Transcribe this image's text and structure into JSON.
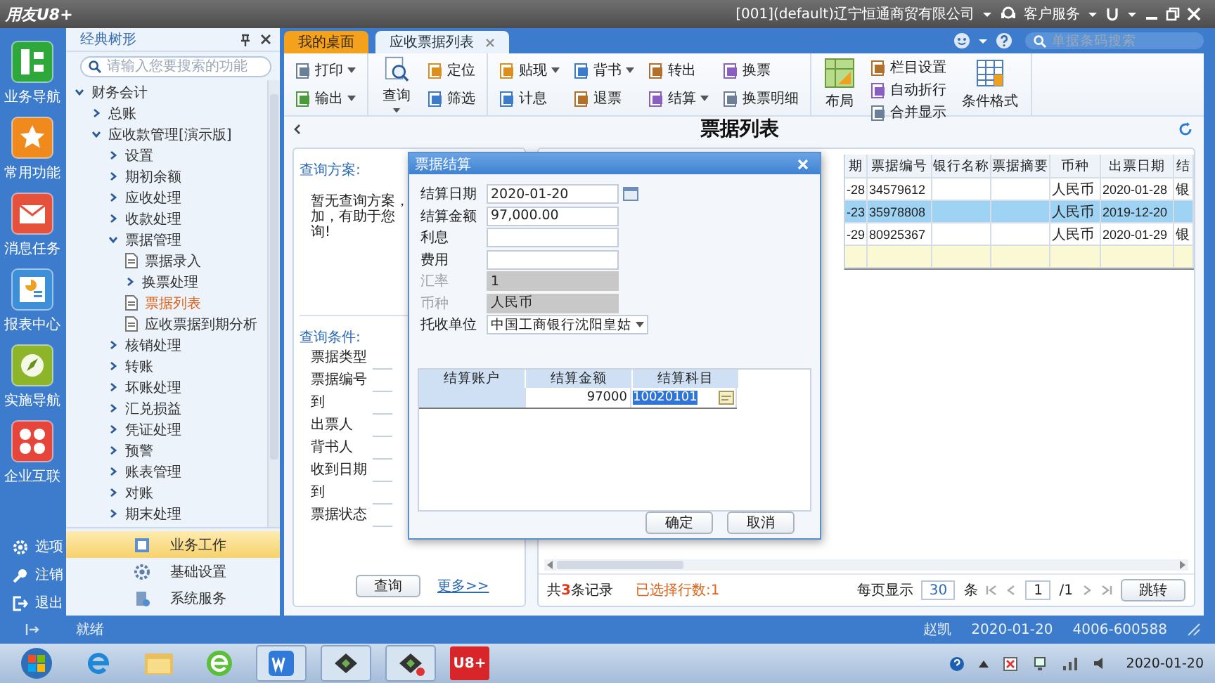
{
  "title_bar": {
    "app_name": "用友U8+",
    "company": "[001](default)辽宁恒通商贸有限公司",
    "service": "客户服务"
  },
  "nav": {
    "items": [
      "业务导航",
      "常用功能",
      "消息任务",
      "报表中心",
      "实施导航",
      "企业互联"
    ],
    "bottom": [
      "选项",
      "注销",
      "退出"
    ]
  },
  "tree_panel": {
    "title": "经典树形",
    "search_placeholder": "请输入您要搜索的功能",
    "tree": [
      {
        "label": "财务会计",
        "kind": "folder",
        "expanded": true,
        "selected": false,
        "children": [
          {
            "label": "总账",
            "kind": "folder",
            "expanded": false,
            "selected": false
          },
          {
            "label": "应收款管理[演示版]",
            "kind": "folder",
            "expanded": true,
            "selected": false,
            "children": [
              {
                "label": "设置",
                "kind": "folder",
                "expanded": false,
                "selected": false
              },
              {
                "label": "期初余额",
                "kind": "folder",
                "expanded": false,
                "selected": false
              },
              {
                "label": "应收处理",
                "kind": "folder",
                "expanded": false,
                "selected": false
              },
              {
                "label": "收款处理",
                "kind": "folder",
                "expanded": false,
                "selected": false
              },
              {
                "label": "票据管理",
                "kind": "folder",
                "expanded": true,
                "selected": false,
                "children": [
                  {
                    "label": "票据录入",
                    "kind": "doc",
                    "selected": false
                  },
                  {
                    "label": "换票处理",
                    "kind": "folder",
                    "expanded": false,
                    "selected": false
                  },
                  {
                    "label": "票据列表",
                    "kind": "doc",
                    "selected": true
                  },
                  {
                    "label": "应收票据到期分析",
                    "kind": "doc",
                    "selected": false
                  }
                ]
              },
              {
                "label": "核销处理",
                "kind": "folder",
                "expanded": false,
                "selected": false
              },
              {
                "label": "转账",
                "kind": "folder",
                "expanded": false,
                "selected": false
              },
              {
                "label": "坏账处理",
                "kind": "folder",
                "expanded": false,
                "selected": false
              },
              {
                "label": "汇兑损益",
                "kind": "folder",
                "expanded": false,
                "selected": false
              },
              {
                "label": "凭证处理",
                "kind": "folder",
                "expanded": false,
                "selected": false
              },
              {
                "label": "预警",
                "kind": "folder",
                "expanded": false,
                "selected": false
              },
              {
                "label": "账表管理",
                "kind": "folder",
                "expanded": false,
                "selected": false
              },
              {
                "label": "对账",
                "kind": "folder",
                "expanded": false,
                "selected": false
              },
              {
                "label": "期末处理",
                "kind": "folder",
                "expanded": false,
                "selected": false
              }
            ]
          }
        ]
      }
    ],
    "modules": [
      {
        "label": "业务工作",
        "selected": true
      },
      {
        "label": "基础设置",
        "selected": false
      },
      {
        "label": "系统服务",
        "selected": false
      }
    ]
  },
  "tabs": [
    {
      "label": "我的桌面",
      "selected": false,
      "closable": false
    },
    {
      "label": "应收票据列表",
      "selected": true,
      "closable": true
    }
  ],
  "barcode_search": {
    "placeholder": "单据条码搜索"
  },
  "toolbar": {
    "groups": [
      {
        "columns": [
          {
            "kind": "stack",
            "items": [
              {
                "label": "打印",
                "dropdown": true
              },
              {
                "label": "输出",
                "dropdown": true
              }
            ]
          }
        ]
      },
      {
        "columns": [
          {
            "kind": "large",
            "label": "查询",
            "dropdown": true
          },
          {
            "kind": "stack",
            "items": [
              {
                "label": "定位",
                "dropdown": false
              },
              {
                "label": "筛选",
                "dropdown": false
              }
            ]
          }
        ]
      },
      {
        "columns": [
          {
            "kind": "stack",
            "items": [
              {
                "label": "贴现",
                "dropdown": true
              },
              {
                "label": "计息",
                "dropdown": false
              }
            ]
          },
          {
            "kind": "stack",
            "items": [
              {
                "label": "背书",
                "dropdown": true
              },
              {
                "label": "退票",
                "dropdown": false
              }
            ]
          },
          {
            "kind": "stack",
            "items": [
              {
                "label": "转出",
                "dropdown": false
              },
              {
                "label": "结算",
                "dropdown": true
              }
            ]
          },
          {
            "kind": "stack",
            "items": [
              {
                "label": "换票",
                "dropdown": false
              },
              {
                "label": "换票明细",
                "dropdown": false
              }
            ]
          }
        ]
      },
      {
        "columns": [
          {
            "kind": "large",
            "label": "布局",
            "dropdown": false
          },
          {
            "kind": "stack",
            "items": [
              {
                "label": "栏目设置",
                "dropdown": false
              },
              {
                "label": "自动折行",
                "dropdown": false
              },
              {
                "label": "合并显示",
                "dropdown": false
              }
            ]
          },
          {
            "kind": "large",
            "label": "条件格式",
            "dropdown": false
          }
        ]
      }
    ]
  },
  "page_title": "票据列表",
  "query": {
    "scheme_label": "查询方案:",
    "notice": [
      "暂无查询方案，",
      "加，有助于您",
      "询!"
    ],
    "conditions_label": "查询条件:",
    "conditions": [
      "票据类型",
      "票据编号",
      "到",
      "出票人",
      "背书人",
      "收到日期",
      "到",
      "票据状态"
    ],
    "search_button": "查询",
    "more_link": "更多>>"
  },
  "table": {
    "columns": [
      "期",
      "票据编号",
      "银行名称",
      "票据摘要",
      "币种",
      "出票日期",
      "结"
    ],
    "rows": [
      {
        "cells": [
          "-28",
          "34579612",
          "",
          "",
          "人民币",
          "2020-01-28",
          "银"
        ],
        "selected": false
      },
      {
        "cells": [
          "-23",
          "35978808",
          "",
          "",
          "人民币",
          "2019-12-20",
          ""
        ],
        "selected": true
      },
      {
        "cells": [
          "-29",
          "80925367",
          "",
          "",
          "人民币",
          "2020-01-29",
          "银"
        ],
        "selected": false
      }
    ]
  },
  "footer": {
    "count_text": "共**3**条记录",
    "selected_text": "已选择行数:1",
    "per_page_label": "每页显示",
    "per_page": "30",
    "per_page_unit": "条",
    "page": "1",
    "page_total": "/1",
    "jump_button": "跳转"
  },
  "dialog": {
    "title": "票据结算",
    "fields": [
      {
        "label": "结算日期",
        "value": "2020-01-20",
        "kind": "date",
        "disabled": false
      },
      {
        "label": "结算金额",
        "value": "97,000.00",
        "kind": "text",
        "disabled": false
      },
      {
        "label": "利息",
        "kind": "text",
        "disabled": false
      },
      {
        "label": "费用",
        "kind": "text",
        "disabled": false
      },
      {
        "label": "汇率",
        "value": "1",
        "kind": "text",
        "disabled": true
      },
      {
        "label": "币种",
        "value": "人民币",
        "kind": "text",
        "disabled": true
      },
      {
        "label": "托收单位",
        "value": "中国工商银行沈阳皇姑",
        "kind": "select",
        "disabled": false
      }
    ],
    "grid": {
      "columns": [
        "结算账户",
        "结算金额",
        "结算科目"
      ],
      "rows": [
        {
          "amount": "97000",
          "subject": "10020101",
          "subject_selected": true
        }
      ]
    },
    "buttons": [
      "确定",
      "取消"
    ]
  },
  "status_bar": {
    "state": "就绪",
    "user": "赵凯",
    "date": "2020-01-20",
    "phone": "4006-600588"
  },
  "taskbar": {
    "app_label": "U8+",
    "clock": "2020-01-20"
  }
}
